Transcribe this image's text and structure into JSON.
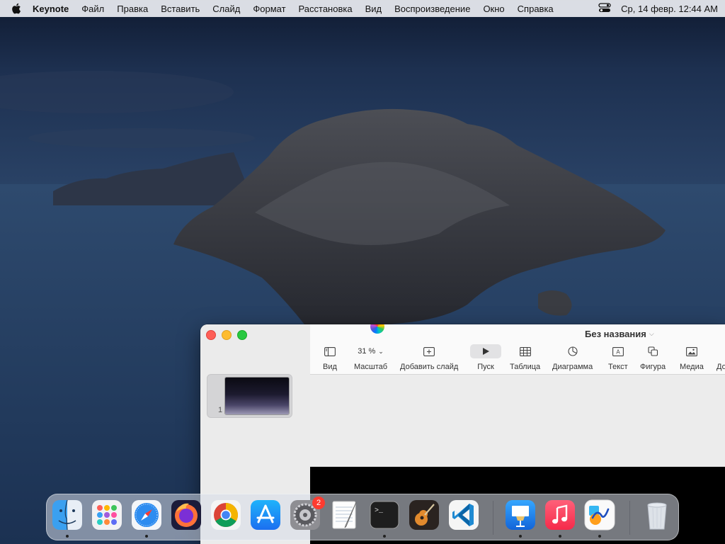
{
  "menubar": {
    "app_name": "Keynote",
    "items": [
      "Файл",
      "Правка",
      "Вставить",
      "Слайд",
      "Формат",
      "Расстановка",
      "Вид",
      "Воспроизведение",
      "Окно",
      "Справка"
    ],
    "datetime": "Ср, 14 февр.  12:44 AM"
  },
  "window": {
    "title": "Без названия",
    "toolbar": {
      "view_label": "Вид",
      "zoom_value": "31 %",
      "zoom_label": "Масштаб",
      "add_slide_label": "Добавить слайд",
      "play_label": "Пуск",
      "table_label": "Таблица",
      "chart_label": "Диаграмма",
      "text_label": "Текст",
      "shape_label": "Фигура",
      "media_label": "Медиа",
      "comment_label_partial": "До"
    },
    "slides": [
      {
        "number": "1"
      }
    ]
  },
  "dock": {
    "apps": [
      "finder",
      "launchpad",
      "safari",
      "firefox",
      "chrome",
      "app-store",
      "system-preferences",
      "textedit",
      "terminal",
      "garageband",
      "vscode",
      "keynote",
      "music",
      "freeform",
      "trash"
    ],
    "system_preferences_badge": "2"
  }
}
